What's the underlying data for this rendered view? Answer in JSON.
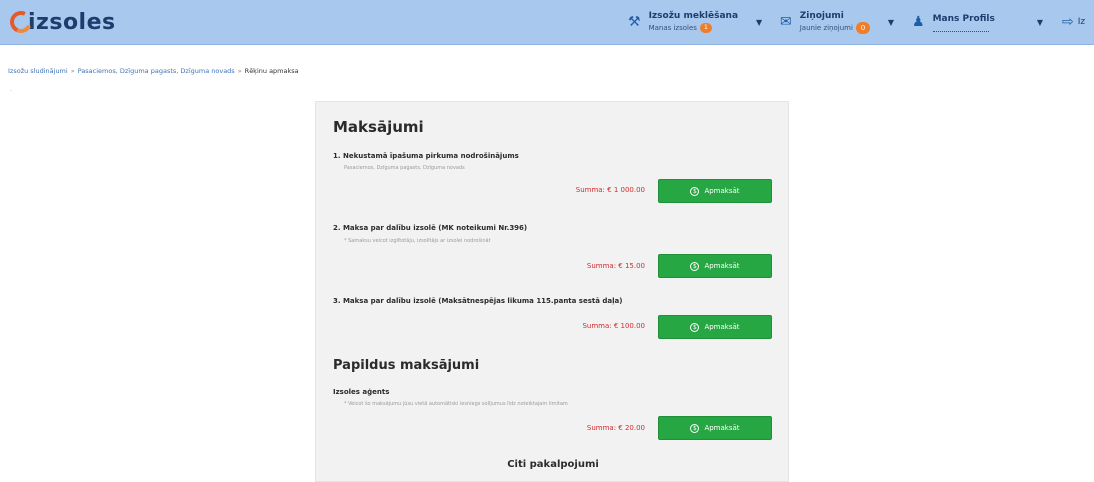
{
  "header": {
    "logo_text": "izsoles",
    "auctions": {
      "title": "Izsožu meklēšana",
      "subtitle": "Manas izsoles",
      "count": "1"
    },
    "messages": {
      "title": "Ziņojumi",
      "subtitle": "Jaunie ziņojumi",
      "count": "0"
    },
    "profile": {
      "title": "Mans Profils"
    },
    "logout_label": "Iz"
  },
  "breadcrumb": {
    "items": [
      "Izsožu sludinājumi",
      "Pasaciemos, Dzīguma pagasts, Dzīguma novads"
    ],
    "current": "Rēķinu apmaksa",
    "separator": "»"
  },
  "payments": {
    "title": "Maksājumi",
    "items": [
      {
        "title": "1. Nekustamā īpašuma pirkuma nodrošinājums",
        "subtitle": "Pasaciemos, Dzīguma pagasts, Dzīguma novads",
        "amount": "Summa: € 1 000.00",
        "button": "Apmaksāt"
      },
      {
        "title": "2. Maksa par dalību izsolē (MK noteikumi Nr.396)",
        "subtitle": "* Samaksu veicot izglītotāju, izsolītājs ar izsolei nodrošināt",
        "amount": "Summa: € 15.00",
        "button": "Apmaksāt"
      },
      {
        "title": "3. Maksa par dalību izsolē (Maksātnespējas likuma 115.panta sestā daļa)",
        "subtitle": "",
        "amount": "Summa: € 100.00",
        "button": "Apmaksāt"
      }
    ]
  },
  "additional": {
    "title": "Papildus maksājumi",
    "items": [
      {
        "title": "Izsoles aģents",
        "subtitle": "* Veicot šo maksājumu jūsu vietā automātiski iesniegs solījumus līdz noteiktajam limitam",
        "amount": "Summa: € 20.00",
        "button": "Apmaksāt"
      }
    ]
  },
  "other_services": {
    "title": "Citi pakalpojumi"
  }
}
